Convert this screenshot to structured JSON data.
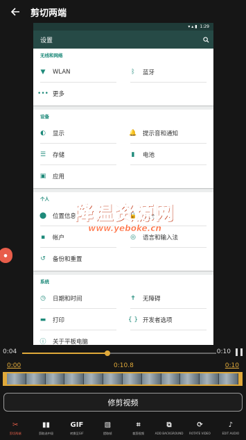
{
  "appbar": {
    "title": "剪切两端"
  },
  "preview": {
    "status_time": "1:29",
    "toolbar_title": "设置",
    "sections": [
      {
        "title": "无线和网络",
        "items": [
          {
            "icon": "wifi-icon",
            "glyph": "▼",
            "label": "WLAN"
          },
          {
            "icon": "bluetooth-icon",
            "glyph": "ᛒ",
            "label": "蓝牙"
          },
          {
            "icon": "more-icon",
            "glyph": "•••",
            "label": "更多"
          }
        ]
      },
      {
        "title": "设备",
        "items": [
          {
            "icon": "display-icon",
            "glyph": "◐",
            "label": "显示"
          },
          {
            "icon": "bell-icon",
            "glyph": "🔔",
            "label": "提示音和通知"
          },
          {
            "icon": "storage-icon",
            "glyph": "☰",
            "label": "存储"
          },
          {
            "icon": "battery-icon",
            "glyph": "▮",
            "label": "电池"
          },
          {
            "icon": "apps-icon",
            "glyph": "▣",
            "label": "应用"
          }
        ]
      },
      {
        "title": "个人",
        "items": [
          {
            "icon": "location-icon",
            "glyph": "⬤",
            "label": "位置信息"
          },
          {
            "icon": "security-icon",
            "glyph": "🔒",
            "label": "安全"
          },
          {
            "icon": "account-icon",
            "glyph": "▪",
            "label": "帐户"
          },
          {
            "icon": "language-icon",
            "glyph": "◎",
            "label": "语言和输入法"
          },
          {
            "icon": "backup-icon",
            "glyph": "↺",
            "label": "备份和重置"
          }
        ]
      },
      {
        "title": "系统",
        "items": [
          {
            "icon": "clock-icon",
            "glyph": "◷",
            "label": "日期和时间"
          },
          {
            "icon": "accessibility-icon",
            "glyph": "✝",
            "label": "无障碍"
          },
          {
            "icon": "print-icon",
            "glyph": "▬",
            "label": "打印"
          },
          {
            "icon": "developer-icon",
            "glyph": "{ }",
            "label": "开发者选项"
          },
          {
            "icon": "info-icon",
            "glyph": "ⓘ",
            "label": "关于平板电脑"
          }
        ]
      }
    ]
  },
  "watermark": {
    "cn": "降温资源网",
    "url": "www.yeboke.cn"
  },
  "fab": {
    "label": "●"
  },
  "playback": {
    "current": "0:04",
    "end": "0:10",
    "progress": 0.44
  },
  "trim": {
    "start": "0:00",
    "mid": "0:10.8",
    "end": "0:10"
  },
  "action": {
    "trim_label": "修剪视频"
  },
  "tools": [
    {
      "name": "cut-ends",
      "icon": "✂",
      "label": "剪切两端",
      "active": true
    },
    {
      "name": "cut-middle",
      "icon": "▮▮",
      "label": "剪取选中段"
    },
    {
      "name": "to-gif",
      "icon": "GIF",
      "label": "转换至GIF"
    },
    {
      "name": "extract-frame",
      "icon": "▧",
      "label": "提取帧"
    },
    {
      "name": "crop",
      "icon": "⌗",
      "label": "裁剪视频"
    },
    {
      "name": "add-background",
      "icon": "⧉",
      "label": "ADD BACKGROUND"
    },
    {
      "name": "rotate-video",
      "icon": "⟳",
      "label": "ROTATE VIDEO"
    },
    {
      "name": "edit-audio",
      "icon": "♪",
      "label": "EDIT AUDIO"
    }
  ]
}
